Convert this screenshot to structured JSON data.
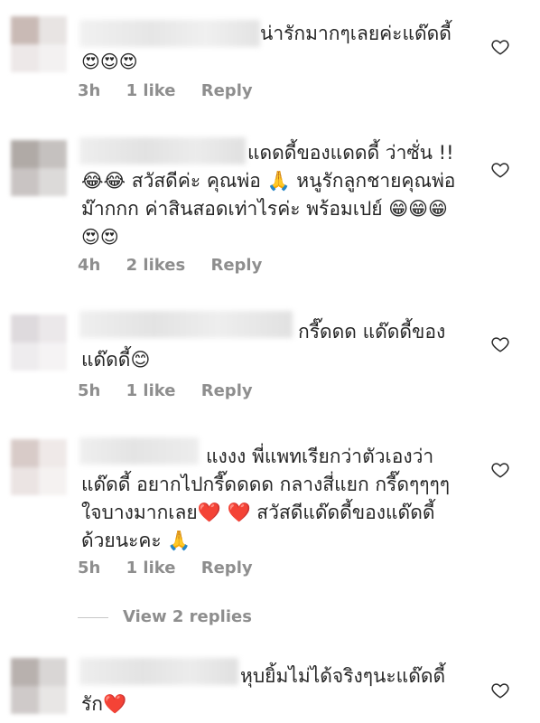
{
  "comments": [
    {
      "lines": [
        "น่ารักมากๆเลยค่ะแด๊ดดี้",
        "😍😍😍"
      ],
      "time": "3h",
      "likes": "1 like",
      "reply": "Reply"
    },
    {
      "lines": [
        "แดดดี้ของแดดดี้ ว่าซั่น !!",
        "😂😂 สวัสดีค่ะ คุณพ่อ 🙏 หนูรักลูกชายคุณพ่อ",
        "ม๊ากกก ค่าสินสอดเท่าไรค่ะ พร้อมเปย์ 😁😁😁",
        "😍😍"
      ],
      "time": "4h",
      "likes": "2 likes",
      "reply": "Reply"
    },
    {
      "lines": [
        "กรี๊ดดด แด๊ดดี้ของ",
        "แด๊ดดี้😊"
      ],
      "time": "5h",
      "likes": "1 like",
      "reply": "Reply"
    },
    {
      "lines": [
        "แงงง พี่แพทเรียกว่าตัวเองว่า",
        "แด๊ดดี้ อยากไปกรี๊ดดดด กลางสี่แยก กรี๊ดๆๆๆๆ",
        "ใจบางมากเลย❤️ ❤️ สวัสดีแด๊ดดี้ของแด๊ดดี้",
        "ด้วยนะคะ 🙏"
      ],
      "time": "5h",
      "likes": "1 like",
      "reply": "Reply"
    },
    {
      "lines": [
        "หุบยิ้มไม่ได้จริงๆนะแด๊ดดี้",
        "รัก❤️"
      ]
    }
  ],
  "view_replies": "View 2 replies"
}
